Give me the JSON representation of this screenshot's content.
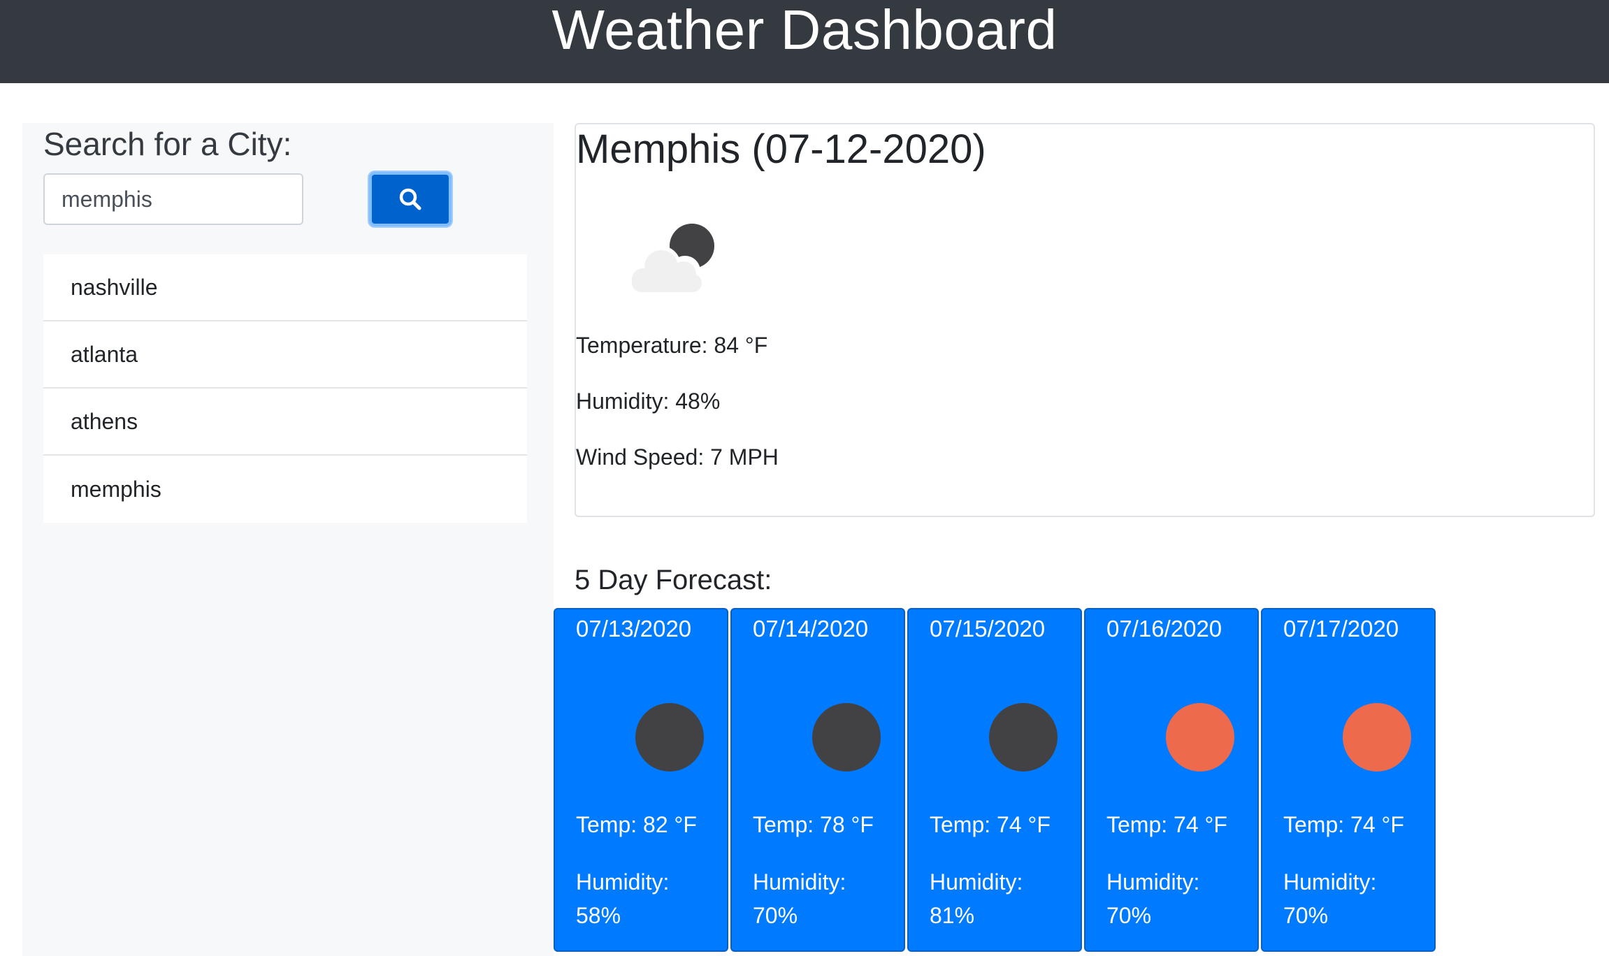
{
  "header": {
    "title": "Weather Dashboard"
  },
  "search": {
    "title": "Search for a City:",
    "input_value": "memphis",
    "button_icon": "search-icon",
    "button_color": "#0062cc"
  },
  "history": {
    "items": [
      "nashville",
      "atlanta",
      "athens",
      "memphis"
    ]
  },
  "current": {
    "title": "Memphis (07-12-2020)",
    "icon": "cloud-moon-icon",
    "temperature": "Temperature: 84 °F",
    "humidity": "Humidity: 48%",
    "wind": "Wind Speed: 7 MPH"
  },
  "forecast": {
    "title": "5 Day Forecast:",
    "card_color": "#007bff",
    "days": [
      {
        "date": "07/13/2020",
        "icon": "moon-icon",
        "icon_color": "#424245",
        "temp": "Temp: 82 °F",
        "humidity": "Humidity: 58%"
      },
      {
        "date": "07/14/2020",
        "icon": "moon-icon",
        "icon_color": "#424245",
        "temp": "Temp: 78 °F",
        "humidity": "Humidity: 70%"
      },
      {
        "date": "07/15/2020",
        "icon": "moon-icon",
        "icon_color": "#424245",
        "temp": "Temp: 74 °F",
        "humidity": "Humidity: 81%"
      },
      {
        "date": "07/16/2020",
        "icon": "sun-icon",
        "icon_color": "#ee6a4c",
        "temp": "Temp: 74 °F",
        "humidity": "Humidity: 70%"
      },
      {
        "date": "07/17/2020",
        "icon": "sun-icon",
        "icon_color": "#ee6a4c",
        "temp": "Temp: 74 °F",
        "humidity": "Humidity: 70%"
      }
    ]
  }
}
